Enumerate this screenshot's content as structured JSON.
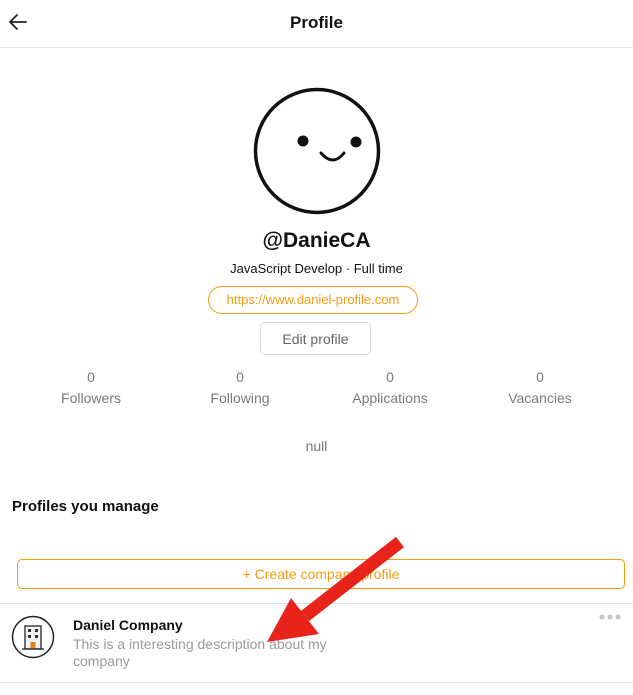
{
  "header": {
    "title": "Profile",
    "back_icon": "arrow-left-icon"
  },
  "profile": {
    "avatar_icon": "smiley-face-icon",
    "handle": "@DanieCA",
    "subtitle": "JavaScript Develop · Full time",
    "website": "https://www.daniel-profile.com",
    "edit_label": "Edit profile",
    "bio": "null"
  },
  "stats": [
    {
      "count": "0",
      "label": "Followers"
    },
    {
      "count": "0",
      "label": "Following"
    },
    {
      "count": "0",
      "label": "Applications"
    },
    {
      "count": "0",
      "label": "Vacancies"
    }
  ],
  "manage": {
    "title": "Profiles you manage",
    "create_label": "+ Create company profile"
  },
  "companies": [
    {
      "name": "Daniel Company",
      "description": "This is a interesting description about my company",
      "icon": "building-icon"
    }
  ],
  "colors": {
    "accent": "#f39c12",
    "annotation": "#e8231a",
    "muted": "#7a7a7a"
  }
}
